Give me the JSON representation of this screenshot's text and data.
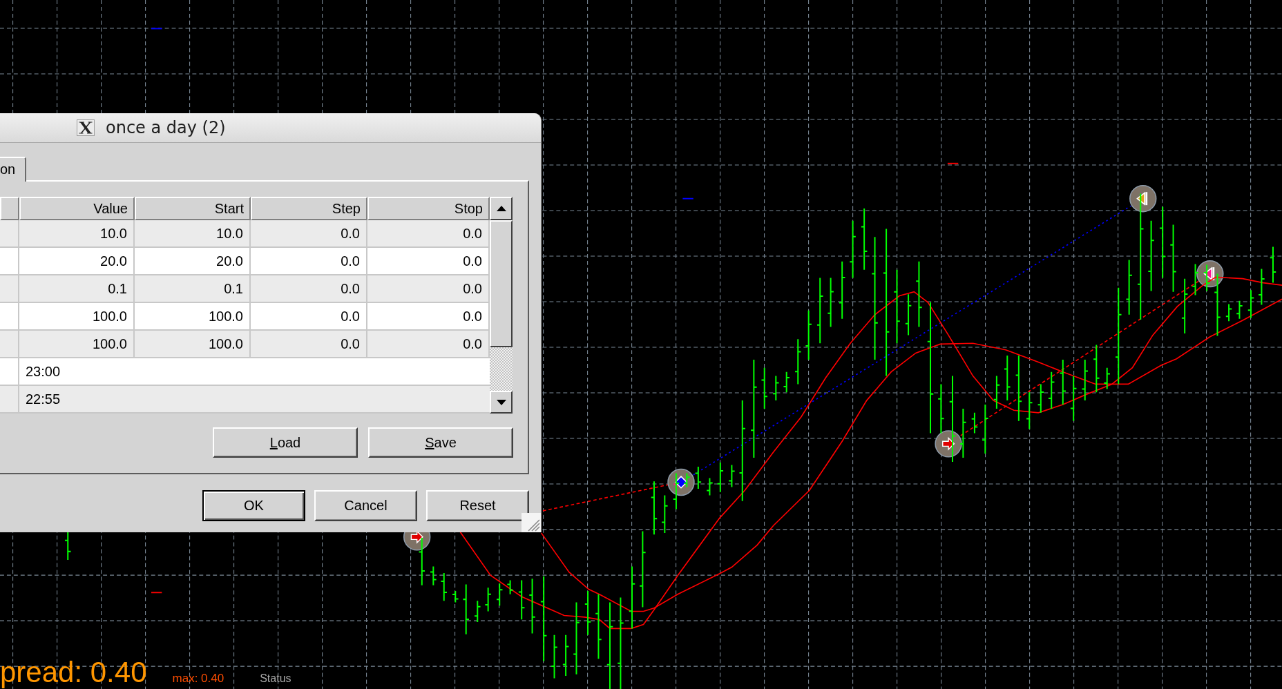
{
  "dialog": {
    "title": "once a day (2)",
    "tabs": [
      {
        "label": "on",
        "selected": true
      }
    ],
    "table": {
      "columns": [
        "Value",
        "Start",
        "Step",
        "Stop"
      ],
      "rows": [
        {
          "kind": "range",
          "cells": [
            "10.0",
            "10.0",
            "0.0",
            "0.0"
          ]
        },
        {
          "kind": "range",
          "cells": [
            "20.0",
            "20.0",
            "0.0",
            "0.0"
          ]
        },
        {
          "kind": "range",
          "cells": [
            "0.1",
            "0.1",
            "0.0",
            "0.0"
          ]
        },
        {
          "kind": "range",
          "cells": [
            "100.0",
            "100.0",
            "0.0",
            "0.0"
          ]
        },
        {
          "kind": "range",
          "cells": [
            "100.0",
            "100.0",
            "0.0",
            "0.0"
          ]
        },
        {
          "kind": "text",
          "value": "23:00"
        },
        {
          "kind": "text",
          "value": "22:55"
        }
      ]
    },
    "panel_buttons": [
      {
        "label": "Load",
        "underlined_key": true
      },
      {
        "label": "Save",
        "underlined_key": true
      }
    ],
    "buttons": [
      {
        "label": "OK",
        "default": true
      },
      {
        "label": "Cancel",
        "default": false
      },
      {
        "label": "Reset",
        "default": false
      }
    ]
  },
  "chart_labels": {
    "spread": "pread: 0.40",
    "max": "max: 0.40",
    "status": "Status"
  }
}
